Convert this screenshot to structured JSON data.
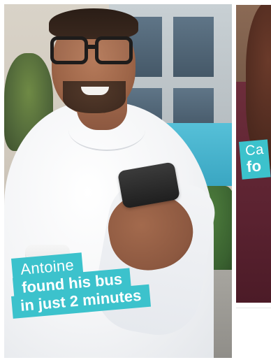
{
  "cards": {
    "main": {
      "name": "Antoine",
      "message_line1": "found his bus",
      "message_line2": "in just 2 minutes"
    },
    "right": {
      "name": "Ca",
      "message": "fo"
    }
  },
  "colors": {
    "accent": "#3cc2cc",
    "frame": "#ffffff"
  }
}
